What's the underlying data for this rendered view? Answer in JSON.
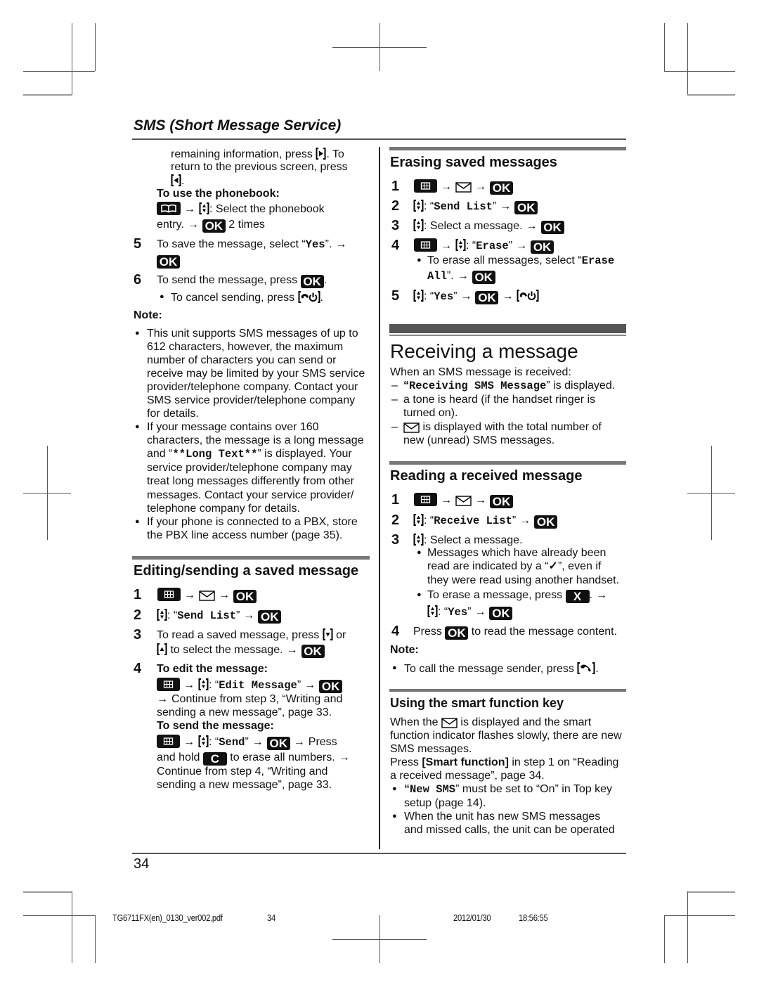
{
  "glyphs": {
    "arrow": "→",
    "bullet": "●",
    "dash": "–",
    "check": "✓",
    "lbr": "[",
    "rbr": "]"
  },
  "keys": {
    "ok": "OK",
    "c": "C",
    "x": "X"
  },
  "header": {
    "title": "SMS (Short Message Service)"
  },
  "left": {
    "cont": {
      "l1a": "remaining information, press ",
      "l1b": ". To",
      "l2": "return to the previous screen, press",
      "l3b": "."
    },
    "phonebook": {
      "label": "To use the phonebook:",
      "l1b": ": Select the phonebook",
      "l2a": "entry.",
      "l2b": " 2 times"
    },
    "step5": {
      "num": "5",
      "a": "To save the message, select “",
      "mono": "Yes",
      "b": "”."
    },
    "step6": {
      "num": "6",
      "a": "To send the message, press ",
      "b": ".",
      "bullet_a": "To cancel sending, press ",
      "bullet_b": "."
    },
    "note": {
      "label": "Note:",
      "b1": {
        "l1": "This unit supports SMS messages of up to",
        "l2": "612 characters, however, the maximum",
        "l3": "number of characters you can send or",
        "l4": "receive may be limited by your SMS service",
        "l5": "provider/telephone company. Contact your",
        "l6": "SMS service provider/telephone company",
        "l7": "for details."
      },
      "b2": {
        "l1": "If your message contains over 160",
        "l2": "characters, the message is a long message",
        "l3a": "and “",
        "l3mono": "**Long Text**",
        "l3b": "” is displayed. Your",
        "l4": "service provider/telephone company may",
        "l5": "treat long messages differently from other",
        "l6": "messages. Contact your service provider/",
        "l7": "telephone company for details."
      },
      "b3": {
        "l1": "If your phone is connected to a PBX, store",
        "l2": "the PBX line access number (page 35)."
      }
    },
    "editing": {
      "title": "Editing/sending a saved message",
      "s1": {
        "num": "1"
      },
      "s2": {
        "num": "2",
        "a": ": “",
        "mono": "Send List",
        "b": "”"
      },
      "s3": {
        "num": "3",
        "l1a": "To read a saved message, press ",
        "l1b": " or",
        "l2b": " to select the message."
      },
      "s4": {
        "num": "4",
        "edit_label": "To edit the message:",
        "edit_a": ": “",
        "edit_mono": "Edit Message",
        "edit_b": "”",
        "edit_l2": "Continue from step 3, “Writing and",
        "edit_l3": "sending a new message”, page 33.",
        "send_label": "To send the message:",
        "send_a": ": “",
        "send_mono": "Send",
        "send_b": "”",
        "send_c": "Press",
        "send_l2a": "and hold ",
        "send_l2b": " to erase all numbers.",
        "send_l3": "Continue from step 4, “Writing and",
        "send_l4": "sending a new message”, page 33."
      }
    }
  },
  "right": {
    "erasing": {
      "title": "Erasing saved messages",
      "s1": {
        "num": "1"
      },
      "s2": {
        "num": "2",
        "a": ": “",
        "mono": "Send List",
        "b": "”"
      },
      "s3": {
        "num": "3",
        "text": ": Select a message."
      },
      "s4": {
        "num": "4",
        "a": ": “",
        "mono": "Erase",
        "b": "”",
        "bullet_a": "To erase all messages, select “",
        "bullet_mono1": "Erase",
        "bullet_mono2": "All",
        "bullet_b": "”."
      },
      "s5": {
        "num": "5",
        "a": ": “",
        "mono": "Yes",
        "b": "”"
      }
    },
    "receiving": {
      "title": "Receiving a message",
      "intro": "When an SMS message is received:",
      "i1": {
        "a": "“",
        "mono": "Receiving SMS Message",
        "b": "” is displayed."
      },
      "i2": {
        "l1": "a tone is heard (if the handset ringer is",
        "l2": "turned on)."
      },
      "i3": {
        "l1b": " is displayed with the total number of",
        "l2": "new (unread) SMS messages."
      }
    },
    "reading": {
      "title": "Reading a received message",
      "s1": {
        "num": "1"
      },
      "s2": {
        "num": "2",
        "a": ": “",
        "mono": "Receive List",
        "b": "”"
      },
      "s3": {
        "num": "3",
        "text": ": Select a message.",
        "b1_l1": "Messages which have already been",
        "b1_l2a": "read are indicated by a “",
        "b1_l2b": "”, even if",
        "b1_l3": "they were read using another handset.",
        "b2_l1a": "To erase a message, press ",
        "b2_l1b": ".",
        "b2_a": ": “",
        "b2_mono": "Yes",
        "b2_b": "”"
      },
      "s4": {
        "num": "4",
        "a": "Press ",
        "b": " to read the message content."
      },
      "note": {
        "label": "Note:",
        "bullet_a": "To call the message sender, press ",
        "bullet_b": "."
      }
    },
    "smart": {
      "title": "Using the smart function key",
      "p1_l1a": "When the ",
      "p1_l1b": " is displayed and the smart",
      "p1_l2": "function indicator flashes slowly, there are new",
      "p1_l3": "SMS messages.",
      "p2_l1a": "Press ",
      "p2_key": "Smart function",
      "p2_l1b": " in step 1 on “Reading",
      "p2_l2": "a received message”, page 34.",
      "b1_a": "“",
      "b1_mono": "New SMS",
      "b1_b": "” must be set to “On” in Top key",
      "b1_l2": "setup (page 14).",
      "b2_l1": "When the unit has new SMS messages",
      "b2_l2": "and missed calls, the unit can be operated"
    }
  },
  "footer": {
    "page_number": "34",
    "file": "TG6711FX(en)_0130_ver002.pdf",
    "file_page": "34",
    "date": "2012/01/30",
    "time": "18:56:55"
  }
}
